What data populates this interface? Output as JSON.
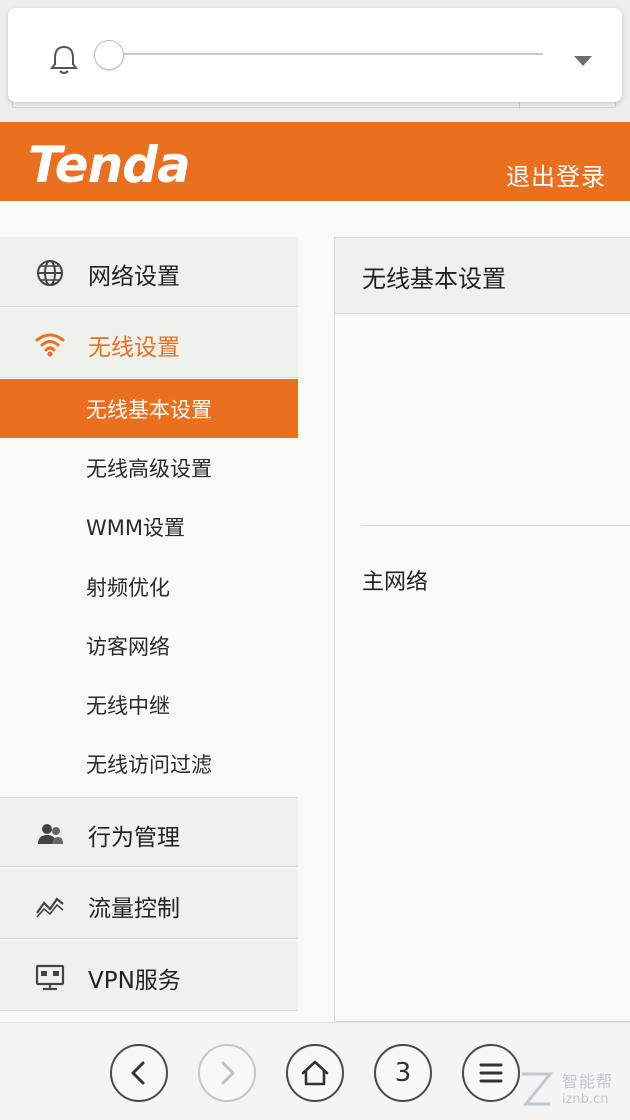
{
  "notification": {
    "icon": "bell-icon",
    "slider_value": 0,
    "caret_icon": "chevron-down-icon"
  },
  "header": {
    "brand": "Tenda",
    "logout_label": "退出登录",
    "accent_color": "#ea6f1e"
  },
  "sidebar": {
    "groups": [
      {
        "label": "网络设置",
        "icon": "globe-icon"
      },
      {
        "label": "无线设置",
        "icon": "wifi-icon"
      },
      {
        "label": "行为管理",
        "icon": "users-icon"
      },
      {
        "label": "流量控制",
        "icon": "chart-line-icon"
      },
      {
        "label": "VPN服务",
        "icon": "monitor-icon"
      }
    ],
    "wireless_items": [
      {
        "label": "无线基本设置"
      },
      {
        "label": "无线高级设置"
      },
      {
        "label": "WMM设置"
      },
      {
        "label": "射频优化"
      },
      {
        "label": "访客网络"
      },
      {
        "label": "无线中继"
      },
      {
        "label": "无线访问过滤"
      }
    ]
  },
  "main": {
    "title": "无线基本设置",
    "section_label": "主网络"
  },
  "toolbar": {
    "back_icon": "back-arrow-icon",
    "forward_icon": "forward-arrow-icon",
    "home_icon": "home-icon",
    "tab_count": "3",
    "menu_icon": "menu-icon"
  },
  "watermark": {
    "text": "智能帮",
    "sub": "iznb.cn"
  }
}
